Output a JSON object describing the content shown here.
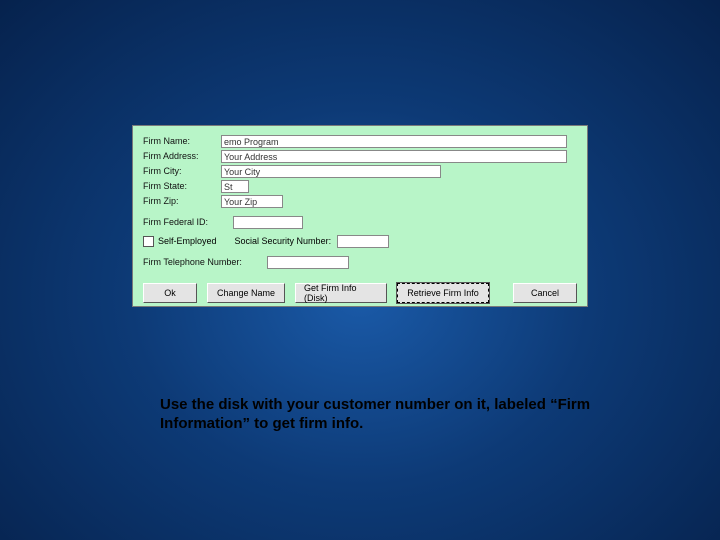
{
  "form": {
    "labels": {
      "name": "Firm Name:",
      "address": "Firm Address:",
      "city": "Firm City:",
      "state": "Firm State:",
      "zip": "Firm Zip:",
      "fedid": "Firm Federal ID:",
      "self_employed": "Self-Employed",
      "ssn": "Social Security Number:",
      "phone": "Firm Telephone Number:"
    },
    "values": {
      "name": "emo Program",
      "address": "Your Address",
      "city": "Your City",
      "state": "St",
      "zip": "Your Zip",
      "fedid": "",
      "ssn": "",
      "phone": ""
    }
  },
  "buttons": {
    "ok": "Ok",
    "change_name": "Change Name",
    "get_disk": "Get Firm Info (Disk)",
    "retrieve": "Retrieve Firm Info",
    "cancel": "Cancel"
  },
  "caption": "Use the disk with your customer number on it, labeled “Firm Information” to get firm info."
}
